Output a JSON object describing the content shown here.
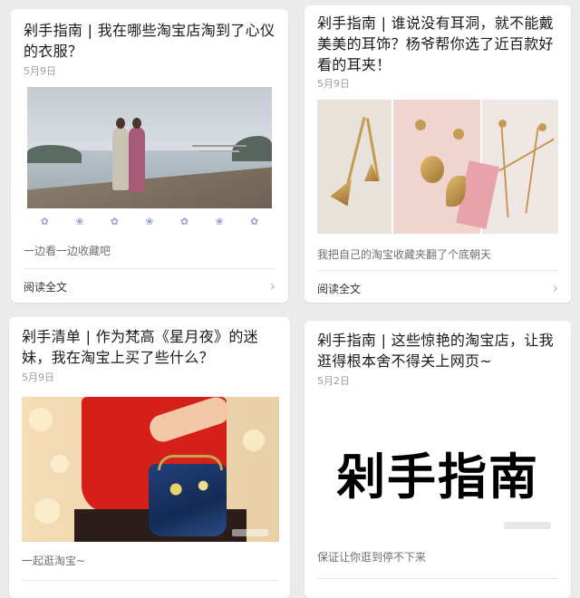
{
  "articles": [
    {
      "title": "剁手指南 | 我在哪些淘宝店淘到了心仪的衣服？",
      "date": "5月9日",
      "summary": "一边看一边收藏吧",
      "read_more": "阅读全文"
    },
    {
      "title": "剁手指南 | 谁说没有耳洞，就不能戴美美的耳饰？杨爷帮你选了近百款好看的耳夹！",
      "date": "5月9日",
      "summary": "我把自己的淘宝收藏夹翻了个底朝天",
      "read_more": "阅读全文"
    },
    {
      "title": "剁手清单 | 作为梵高《星月夜》的迷妹，我在淘宝上买了些什么？",
      "date": "5月9日",
      "summary": "一起逛淘宝~",
      "read_more": ""
    },
    {
      "title": "剁手指南 | 这些惊艳的淘宝店，让我逛得根本舍不得关上网页~",
      "date": "5月2日",
      "summary": "保证让你逛到停不下来",
      "cover_text": "剁手指南",
      "read_more": ""
    }
  ],
  "icons": {
    "chevron": "chevron-right-icon",
    "chevron_glyph": "›"
  },
  "colors": {
    "background": "#ebebeb",
    "card": "#ffffff",
    "date": "#9e9e9e",
    "summary": "#6f6f6f"
  }
}
